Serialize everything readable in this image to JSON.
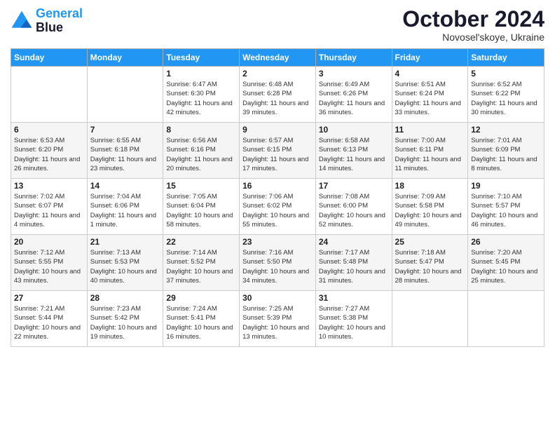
{
  "logo": {
    "line1": "General",
    "line2": "Blue"
  },
  "title": "October 2024",
  "location": "Novosel'skoye, Ukraine",
  "days_of_week": [
    "Sunday",
    "Monday",
    "Tuesday",
    "Wednesday",
    "Thursday",
    "Friday",
    "Saturday"
  ],
  "weeks": [
    [
      {
        "day": "",
        "info": ""
      },
      {
        "day": "",
        "info": ""
      },
      {
        "day": "1",
        "info": "Sunrise: 6:47 AM\nSunset: 6:30 PM\nDaylight: 11 hours and 42 minutes."
      },
      {
        "day": "2",
        "info": "Sunrise: 6:48 AM\nSunset: 6:28 PM\nDaylight: 11 hours and 39 minutes."
      },
      {
        "day": "3",
        "info": "Sunrise: 6:49 AM\nSunset: 6:26 PM\nDaylight: 11 hours and 36 minutes."
      },
      {
        "day": "4",
        "info": "Sunrise: 6:51 AM\nSunset: 6:24 PM\nDaylight: 11 hours and 33 minutes."
      },
      {
        "day": "5",
        "info": "Sunrise: 6:52 AM\nSunset: 6:22 PM\nDaylight: 11 hours and 30 minutes."
      }
    ],
    [
      {
        "day": "6",
        "info": "Sunrise: 6:53 AM\nSunset: 6:20 PM\nDaylight: 11 hours and 26 minutes."
      },
      {
        "day": "7",
        "info": "Sunrise: 6:55 AM\nSunset: 6:18 PM\nDaylight: 11 hours and 23 minutes."
      },
      {
        "day": "8",
        "info": "Sunrise: 6:56 AM\nSunset: 6:16 PM\nDaylight: 11 hours and 20 minutes."
      },
      {
        "day": "9",
        "info": "Sunrise: 6:57 AM\nSunset: 6:15 PM\nDaylight: 11 hours and 17 minutes."
      },
      {
        "day": "10",
        "info": "Sunrise: 6:58 AM\nSunset: 6:13 PM\nDaylight: 11 hours and 14 minutes."
      },
      {
        "day": "11",
        "info": "Sunrise: 7:00 AM\nSunset: 6:11 PM\nDaylight: 11 hours and 11 minutes."
      },
      {
        "day": "12",
        "info": "Sunrise: 7:01 AM\nSunset: 6:09 PM\nDaylight: 11 hours and 8 minutes."
      }
    ],
    [
      {
        "day": "13",
        "info": "Sunrise: 7:02 AM\nSunset: 6:07 PM\nDaylight: 11 hours and 4 minutes."
      },
      {
        "day": "14",
        "info": "Sunrise: 7:04 AM\nSunset: 6:06 PM\nDaylight: 11 hours and 1 minute."
      },
      {
        "day": "15",
        "info": "Sunrise: 7:05 AM\nSunset: 6:04 PM\nDaylight: 10 hours and 58 minutes."
      },
      {
        "day": "16",
        "info": "Sunrise: 7:06 AM\nSunset: 6:02 PM\nDaylight: 10 hours and 55 minutes."
      },
      {
        "day": "17",
        "info": "Sunrise: 7:08 AM\nSunset: 6:00 PM\nDaylight: 10 hours and 52 minutes."
      },
      {
        "day": "18",
        "info": "Sunrise: 7:09 AM\nSunset: 5:58 PM\nDaylight: 10 hours and 49 minutes."
      },
      {
        "day": "19",
        "info": "Sunrise: 7:10 AM\nSunset: 5:57 PM\nDaylight: 10 hours and 46 minutes."
      }
    ],
    [
      {
        "day": "20",
        "info": "Sunrise: 7:12 AM\nSunset: 5:55 PM\nDaylight: 10 hours and 43 minutes."
      },
      {
        "day": "21",
        "info": "Sunrise: 7:13 AM\nSunset: 5:53 PM\nDaylight: 10 hours and 40 minutes."
      },
      {
        "day": "22",
        "info": "Sunrise: 7:14 AM\nSunset: 5:52 PM\nDaylight: 10 hours and 37 minutes."
      },
      {
        "day": "23",
        "info": "Sunrise: 7:16 AM\nSunset: 5:50 PM\nDaylight: 10 hours and 34 minutes."
      },
      {
        "day": "24",
        "info": "Sunrise: 7:17 AM\nSunset: 5:48 PM\nDaylight: 10 hours and 31 minutes."
      },
      {
        "day": "25",
        "info": "Sunrise: 7:18 AM\nSunset: 5:47 PM\nDaylight: 10 hours and 28 minutes."
      },
      {
        "day": "26",
        "info": "Sunrise: 7:20 AM\nSunset: 5:45 PM\nDaylight: 10 hours and 25 minutes."
      }
    ],
    [
      {
        "day": "27",
        "info": "Sunrise: 7:21 AM\nSunset: 5:44 PM\nDaylight: 10 hours and 22 minutes."
      },
      {
        "day": "28",
        "info": "Sunrise: 7:23 AM\nSunset: 5:42 PM\nDaylight: 10 hours and 19 minutes."
      },
      {
        "day": "29",
        "info": "Sunrise: 7:24 AM\nSunset: 5:41 PM\nDaylight: 10 hours and 16 minutes."
      },
      {
        "day": "30",
        "info": "Sunrise: 7:25 AM\nSunset: 5:39 PM\nDaylight: 10 hours and 13 minutes."
      },
      {
        "day": "31",
        "info": "Sunrise: 7:27 AM\nSunset: 5:38 PM\nDaylight: 10 hours and 10 minutes."
      },
      {
        "day": "",
        "info": ""
      },
      {
        "day": "",
        "info": ""
      }
    ]
  ]
}
